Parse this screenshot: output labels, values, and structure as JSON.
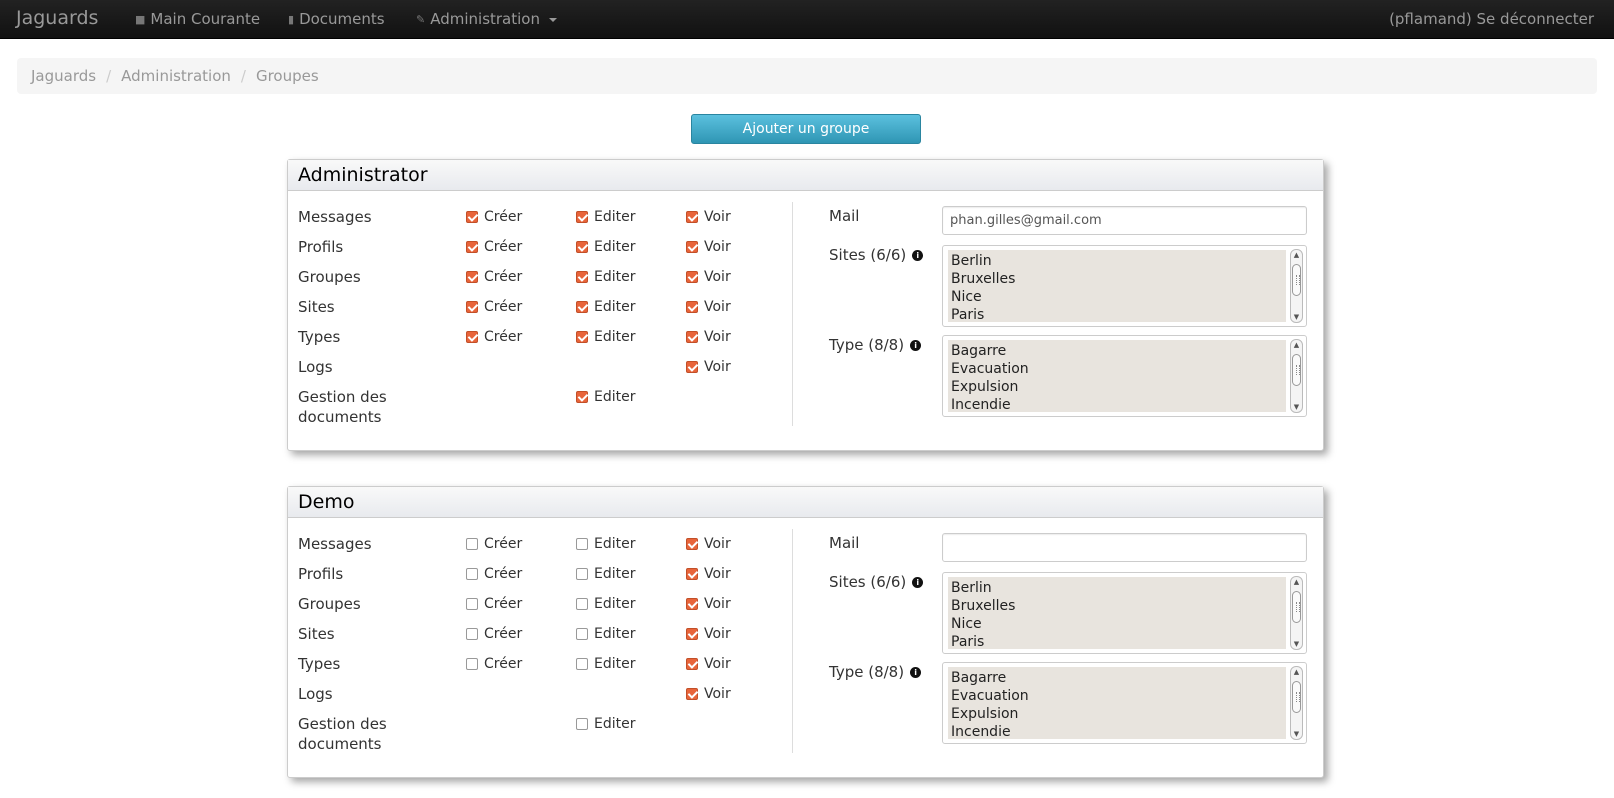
{
  "nav": {
    "brand": "Jaguards",
    "items": [
      {
        "label": "Main Courante",
        "icon": "comment-icon"
      },
      {
        "label": "Documents",
        "icon": "file-icon"
      },
      {
        "label": "Administration",
        "icon": "wrench-icon"
      }
    ],
    "logout": "(pflamand) Se déconnecter"
  },
  "breadcrumb": [
    "Jaguards",
    "Administration",
    "Groupes"
  ],
  "add_button": "Ajouter un groupe",
  "labels": {
    "create": "Créer",
    "edit": "Editer",
    "view": "Voir",
    "mail": "Mail",
    "sites": "Sites (6/6)",
    "types": "Type (8/8)"
  },
  "permission_names": [
    "Messages",
    "Profils",
    "Groupes",
    "Sites",
    "Types",
    "Logs",
    "Gestion des documents"
  ],
  "groups": [
    {
      "name": "Administrator",
      "mail": "phan.gilles@gmail.com",
      "permissions": [
        {
          "create": true,
          "edit": true,
          "view": true
        },
        {
          "create": true,
          "edit": true,
          "view": true
        },
        {
          "create": true,
          "edit": true,
          "view": true
        },
        {
          "create": true,
          "edit": true,
          "view": true
        },
        {
          "create": true,
          "edit": true,
          "view": true
        },
        {
          "create": null,
          "edit": null,
          "view": true
        },
        {
          "create": null,
          "edit": true,
          "view": null
        }
      ],
      "sites": [
        "Berlin",
        "Bruxelles",
        "Nice",
        "Paris"
      ],
      "types": [
        "Bagarre",
        "Evacuation",
        "Expulsion",
        "Incendie"
      ]
    },
    {
      "name": "Demo",
      "mail": "",
      "permissions": [
        {
          "create": false,
          "edit": false,
          "view": true
        },
        {
          "create": false,
          "edit": false,
          "view": true
        },
        {
          "create": false,
          "edit": false,
          "view": true
        },
        {
          "create": false,
          "edit": false,
          "view": true
        },
        {
          "create": false,
          "edit": false,
          "view": true
        },
        {
          "create": null,
          "edit": null,
          "view": true
        },
        {
          "create": null,
          "edit": false,
          "view": null
        }
      ],
      "sites": [
        "Berlin",
        "Bruxelles",
        "Nice",
        "Paris"
      ],
      "types": [
        "Bagarre",
        "Evacuation",
        "Expulsion",
        "Incendie"
      ]
    }
  ]
}
